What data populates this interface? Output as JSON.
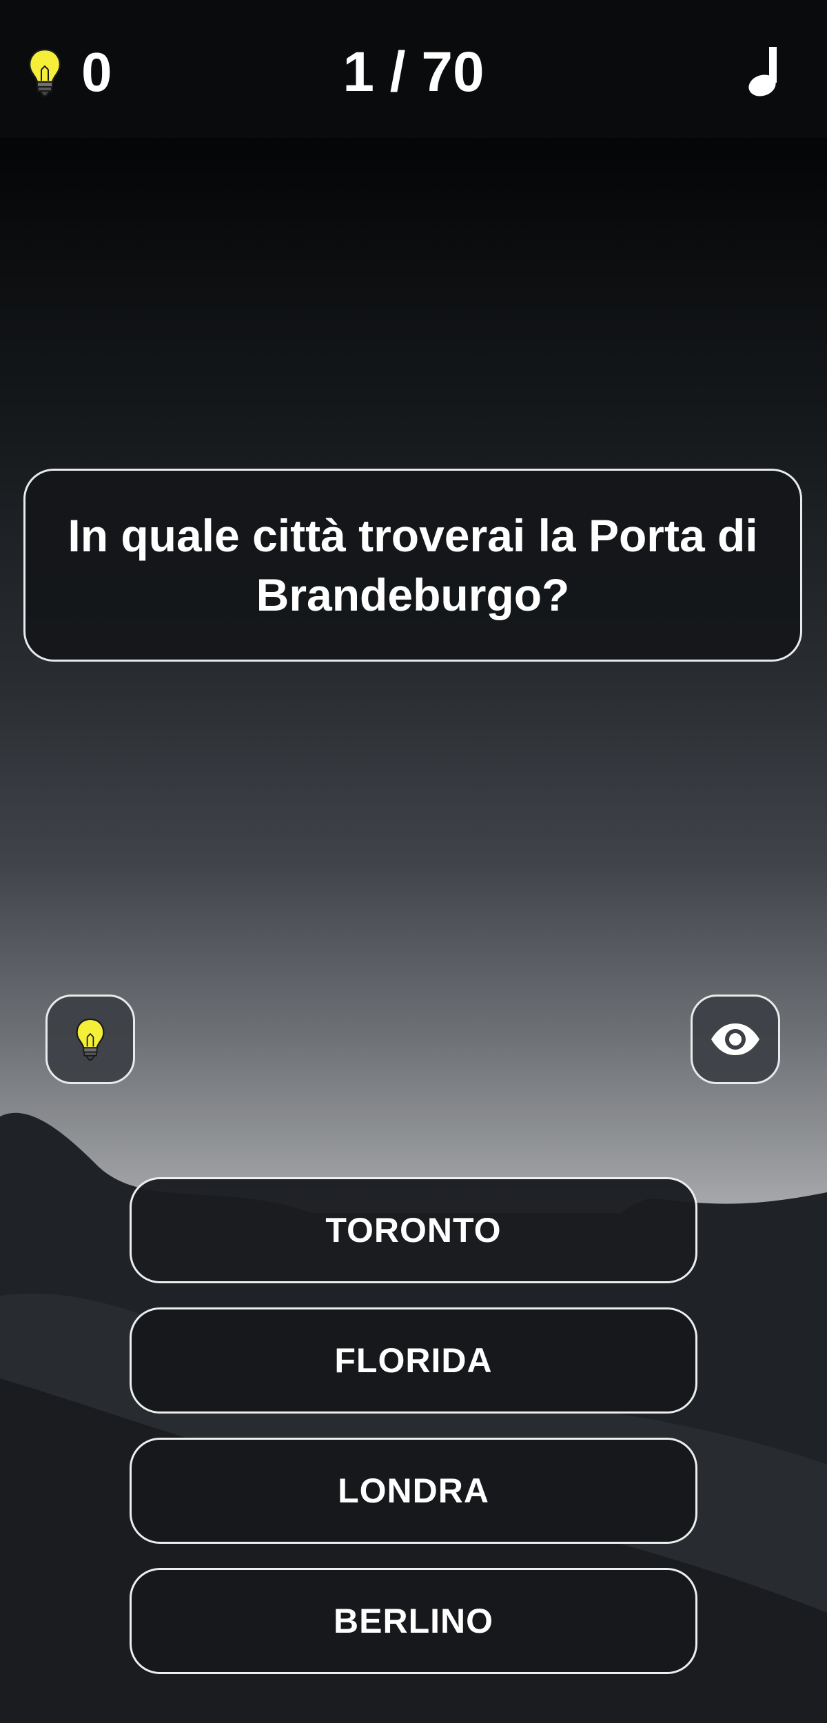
{
  "header": {
    "hint_count": "0",
    "progress": "1 / 70",
    "icons": {
      "hints": "lightbulb-icon",
      "music": "music-note-icon"
    }
  },
  "question": {
    "text": "In quale città troverai la Porta di Brandeburgo?"
  },
  "actions": {
    "hint_icon": "lightbulb-icon",
    "reveal_icon": "eye-icon"
  },
  "answers": [
    {
      "label": "TORONTO"
    },
    {
      "label": "FLORIDA"
    },
    {
      "label": "LONDRA"
    },
    {
      "label": "BERLINO"
    }
  ],
  "colors": {
    "bulb_glass": "#f5ef3a",
    "text": "#ffffff",
    "border": "#e9eaeb"
  }
}
